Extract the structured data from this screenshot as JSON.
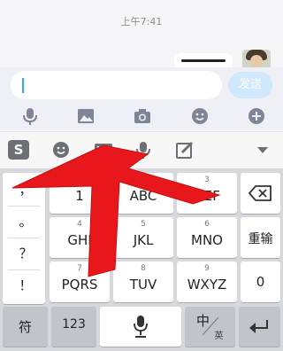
{
  "chat": {
    "time": "上午7:41"
  },
  "input": {
    "value": "",
    "send_label": "发送"
  },
  "toolbar": {
    "items": [
      "voice-icon",
      "image-icon",
      "camera-icon",
      "emoji-icon",
      "plus-icon"
    ]
  },
  "ime_bar": {
    "items": [
      "sogou-logo-icon",
      "emoji-face-icon",
      "keyboard-icon",
      "voice-icon",
      "edit-icon",
      "collapse-icon"
    ],
    "logo_text": "S"
  },
  "keyboard": {
    "symbols": [
      "，",
      "。",
      "？",
      "！"
    ],
    "keys": [
      {
        "num": "1",
        "label": ""
      },
      {
        "num": "2",
        "label": "ABC"
      },
      {
        "num": "3",
        "label": "DEF"
      },
      {
        "num": "4",
        "label": "GHI"
      },
      {
        "num": "5",
        "label": "JKL"
      },
      {
        "num": "6",
        "label": "MNO"
      },
      {
        "num": "7",
        "label": "PQRS"
      },
      {
        "num": "8",
        "label": "TUV"
      },
      {
        "num": "9",
        "label": "WXYZ"
      }
    ],
    "key_1_label": "1",
    "reenter_label": "重输",
    "zero_label": "0",
    "bottom": {
      "symbol": "符",
      "num": "123",
      "lang_main": "中",
      "lang_sub": "英"
    }
  },
  "colors": {
    "accent": "#27aee3",
    "arrow": "#e8171b",
    "send_bg": "#cfe8fb"
  }
}
